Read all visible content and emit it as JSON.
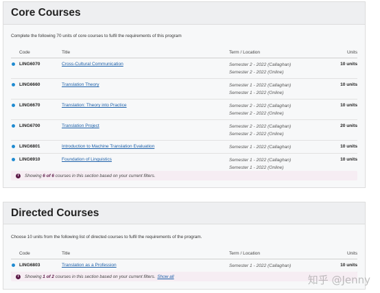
{
  "core": {
    "title": "Core Courses",
    "intro": "Complete the following 70 units of core courses to fulfil the requirements of this program",
    "columns": {
      "code": "Code",
      "title": "Title",
      "term": "Term / Location",
      "units": "Units"
    },
    "rows": [
      {
        "code": "LING6070",
        "title": "Cross-Cultural Communication",
        "terms": [
          "Semester 2 - 2022 (Callaghan)",
          "Semester 2 - 2022 (Online)"
        ],
        "units": "10 units"
      },
      {
        "code": "LING6660",
        "title": "Translation Theory",
        "terms": [
          "Semester 1 - 2022 (Callaghan)",
          "Semester 1 - 2022 (Online)"
        ],
        "units": "10 units"
      },
      {
        "code": "LING6670",
        "title": "Translation: Theory into Practice",
        "terms": [
          "Semester 2 - 2022 (Callaghan)",
          "Semester 2 - 2022 (Online)"
        ],
        "units": "10 units"
      },
      {
        "code": "LING6700",
        "title": "Translation Project",
        "terms": [
          "Semester 2 - 2022 (Callaghan)",
          "Semester 2 - 2022 (Online)"
        ],
        "units": "20 units"
      },
      {
        "code": "LING6801",
        "title": "Introduction to Machine Translation Evaluation",
        "terms": [
          "Semester 1 - 2022 (Callaghan)"
        ],
        "units": "10 units"
      },
      {
        "code": "LING6910",
        "title": "Foundation of Linguistics",
        "terms": [
          "Semester 1 - 2022 (Callaghan)",
          "Semester 1 - 2022 (Online)"
        ],
        "units": "10 units"
      }
    ],
    "notice": {
      "pre": "Showing ",
      "count": "6 of 6",
      "post": " courses in this section based on your current filters."
    }
  },
  "directed": {
    "title": "Directed Courses",
    "intro": "Choose 10 units from the following list of directed courses to fulfil the requirements of the program.",
    "columns": {
      "code": "Code",
      "title": "Title",
      "term": "Term / Location",
      "units": "Units"
    },
    "rows": [
      {
        "code": "LING6803",
        "title": "Translation as a Profession",
        "terms": [
          "Semester 1 - 2022 (Callaghan)"
        ],
        "units": "10 units"
      }
    ],
    "notice": {
      "pre": "Showing ",
      "count": "1 of 2",
      "post": " courses in this section based on your current filters.",
      "link": "Show all"
    }
  },
  "watermark": "知乎 @Jenny",
  "colors": {
    "accent": "#1f8bd1",
    "link": "#1a5ea8",
    "notice_bg": "#f6edf3",
    "brand": "#5a1846"
  }
}
